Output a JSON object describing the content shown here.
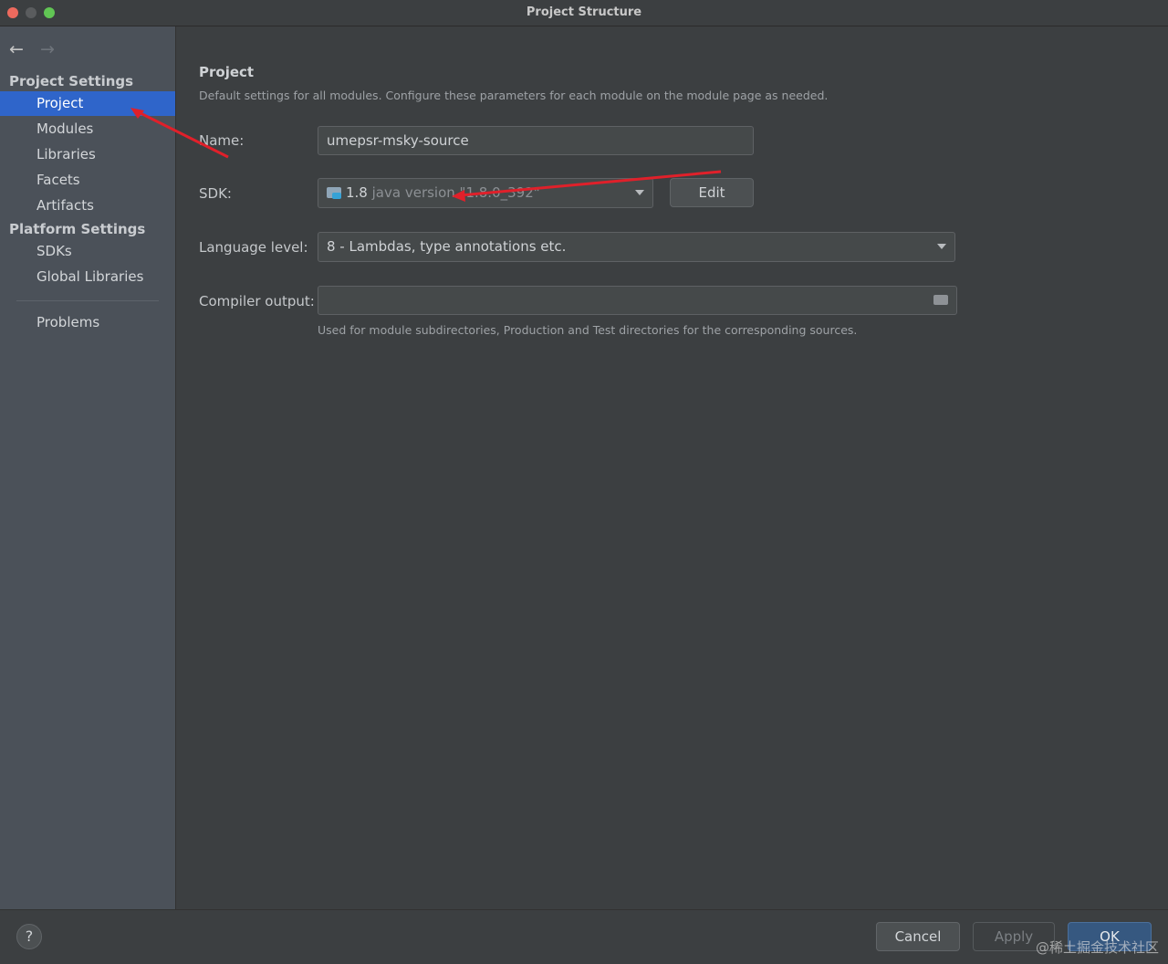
{
  "window": {
    "title": "Project Structure"
  },
  "nav": {
    "back_glyph": "←",
    "forward_glyph": "→"
  },
  "sidebar": {
    "project_settings_header": "Project Settings",
    "platform_settings_header": "Platform Settings",
    "project_items": [
      "Project",
      "Modules",
      "Libraries",
      "Facets",
      "Artifacts"
    ],
    "platform_items": [
      "SDKs",
      "Global Libraries"
    ],
    "problems": "Problems",
    "selected": "Project"
  },
  "main": {
    "title": "Project",
    "description": "Default settings for all modules. Configure these parameters for each module on the module page as needed.",
    "name_label": "Name:",
    "name_value": "umepsr-msky-source",
    "sdk_label": "SDK:",
    "sdk_version": "1.8",
    "sdk_detail": "java version \"1.8.0_392\"",
    "edit_button": "Edit",
    "language_label": "Language level:",
    "language_value": "8 - Lambdas, type annotations etc.",
    "compiler_label": "Compiler output:",
    "compiler_value": "",
    "compiler_hint": "Used for module subdirectories, Production and Test directories for the corresponding sources."
  },
  "footer": {
    "help": "?",
    "cancel": "Cancel",
    "apply": "Apply",
    "ok": "OK"
  },
  "watermark": "@稀土掘金技术社区",
  "colors": {
    "selection": "#2f65ca",
    "annotation_arrow": "#e0202a"
  },
  "icons": [
    "back-arrow-icon",
    "forward-arrow-icon",
    "sdk-folder-icon",
    "dropdown-arrow-icon",
    "browse-folder-icon",
    "help-icon"
  ]
}
